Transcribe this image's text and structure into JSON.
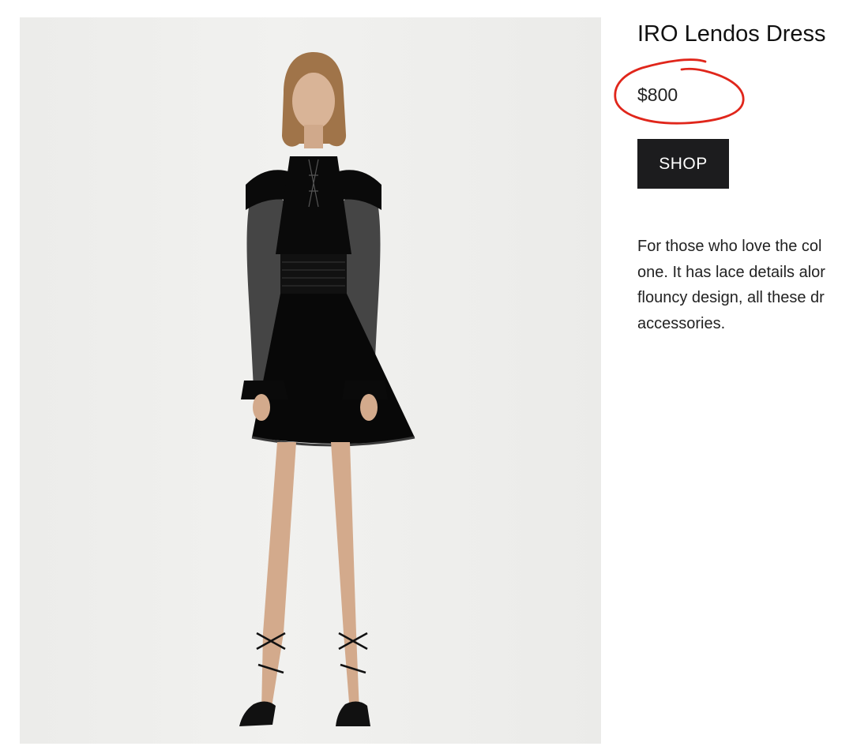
{
  "product": {
    "title": "IRO Lendos Dress",
    "price": "$800",
    "shop_label": "SHOP",
    "description_lines": [
      "For those who love the col",
      "one. It has lace details alor",
      "flouncy design, all these dr",
      "accessories."
    ]
  },
  "colors": {
    "price_highlight": "#e0261b",
    "button_bg": "#1c1c1e",
    "button_text": "#ffffff",
    "photo_backdrop": "#eeeeec",
    "dress": "#0a0a0a",
    "skin": "#d9b497"
  },
  "icons": {
    "price_highlight": "hand-drawn-circle"
  }
}
